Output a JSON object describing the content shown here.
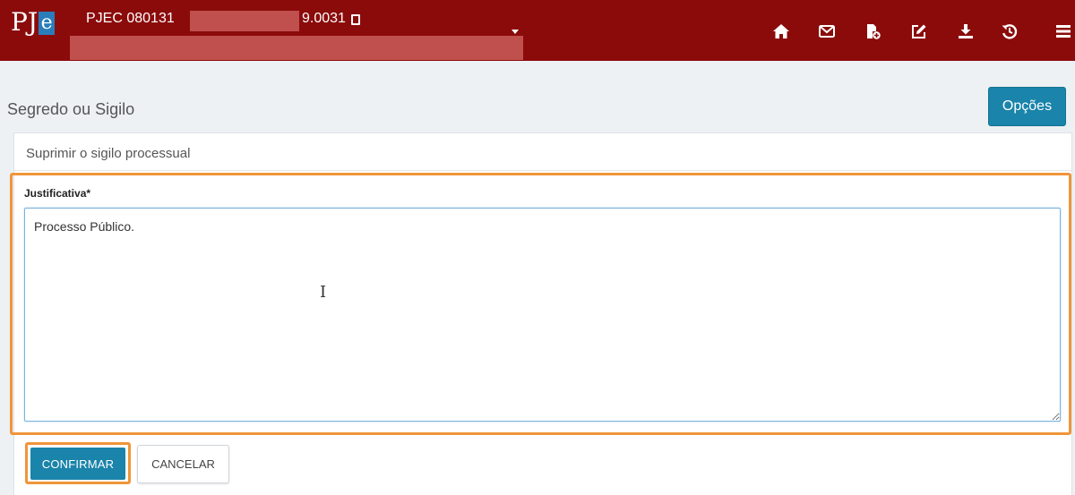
{
  "header": {
    "logo_text": "PJ",
    "logo_accent": "e",
    "process_prefix": "PJEC 080131",
    "process_suffix": "9.0031",
    "icons": [
      "home-icon",
      "envelope-icon",
      "document-add-icon",
      "edit-icon",
      "download-icon",
      "history-icon",
      "menu-icon"
    ],
    "bg_color": "#8b0b0b"
  },
  "page": {
    "title": "Segredo ou Sigilo",
    "options_button": "Opções"
  },
  "panel": {
    "title": "Suprimir o sigilo processual",
    "field_label": "Justificativa*",
    "field_value": "Processo Público."
  },
  "actions": {
    "confirm_label": "CONFIRMAR",
    "cancel_label": "CANCELAR"
  },
  "colors": {
    "accent": "#1a84aa",
    "highlight": "#f0953a",
    "redaction": "#c0504d"
  }
}
